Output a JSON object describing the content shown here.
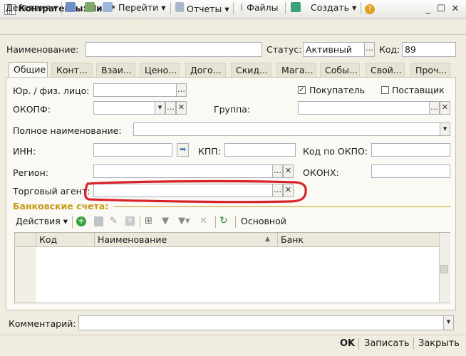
{
  "window": {
    "title": "Контрагенты: Чих *"
  },
  "toolbar": {
    "actions": "Действия",
    "goto": "Перейти",
    "reports": "Отчеты",
    "files": "Файлы",
    "create": "Создать"
  },
  "header": {
    "name_label": "Наименование:",
    "name_value": "",
    "status_label": "Статус:",
    "status_value": "Активный",
    "code_label": "Код:",
    "code_value": "89"
  },
  "tabs": [
    "Общие",
    "Конт...",
    "Взаи...",
    "Цено...",
    "Дого...",
    "Скид...",
    "Мага...",
    "Собы...",
    "Свой...",
    "Проч..."
  ],
  "general": {
    "entity_label": "Юр. / физ. лицо:",
    "buyer_label": "Покупатель",
    "buyer_checked": true,
    "supplier_label": "Поставщик",
    "supplier_checked": false,
    "okopf_label": "ОКОПФ:",
    "group_label": "Группа:",
    "fullname_label": "Полное наименование:",
    "inn_label": "ИНН:",
    "kpp_label": "КПП:",
    "okpo_label": "Код по ОКПО:",
    "region_label": "Регион:",
    "okonh_label": "ОКОНХ:",
    "agent_label": "Торговый агент:"
  },
  "bank": {
    "title": "Банковские счета:",
    "actions": "Действия",
    "main": "Основной",
    "columns": [
      "Код",
      "Наименование",
      "Банк"
    ]
  },
  "comment_label": "Комментарий:",
  "buttons": {
    "ok": "OK",
    "save": "Записать",
    "close": "Закрыть"
  },
  "colors": {
    "annotation": "#d9232a",
    "section_title": "#c59a13"
  }
}
